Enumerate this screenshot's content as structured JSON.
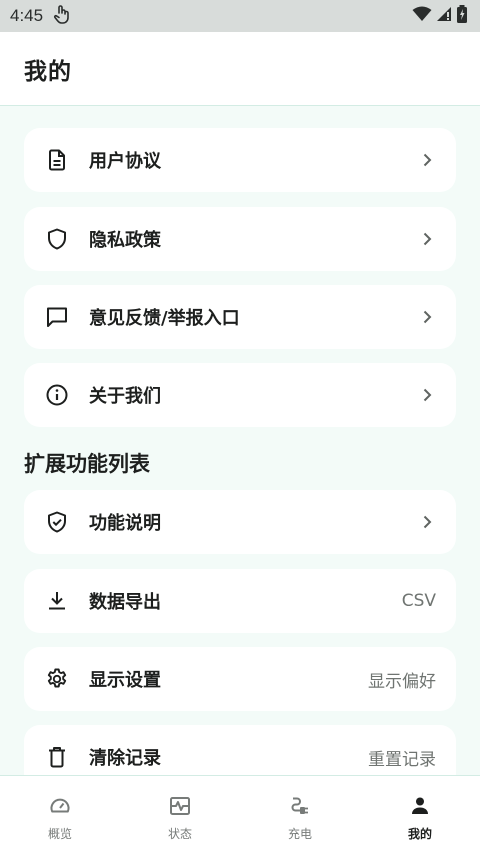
{
  "status_bar": {
    "time": "4:45"
  },
  "app_bar": {
    "title": "我的"
  },
  "menu": [
    {
      "label": "用户协议",
      "icon": "document-icon",
      "trail": ""
    },
    {
      "label": "隐私政策",
      "icon": "shield-icon",
      "trail": ""
    },
    {
      "label": "意见反馈/举报入口",
      "icon": "chat-bubble-icon",
      "trail": ""
    },
    {
      "label": "关于我们",
      "icon": "info-icon",
      "trail": ""
    }
  ],
  "extensions": {
    "title": "扩展功能列表",
    "items": [
      {
        "label": "功能说明",
        "icon": "shield-check-icon",
        "trail": ""
      },
      {
        "label": "数据导出",
        "icon": "download-icon",
        "trail": "CSV"
      },
      {
        "label": "显示设置",
        "icon": "gear-icon",
        "trail": "显示偏好"
      },
      {
        "label": "清除记录",
        "icon": "trash-icon",
        "trail": "重置记录"
      }
    ]
  },
  "bottom_nav": [
    {
      "label": "概览",
      "icon": "gauge-icon",
      "active": false
    },
    {
      "label": "状态",
      "icon": "pulse-icon",
      "active": false
    },
    {
      "label": "充电",
      "icon": "charging-plug-icon",
      "active": false
    },
    {
      "label": "我的",
      "icon": "person-icon",
      "active": true
    }
  ]
}
